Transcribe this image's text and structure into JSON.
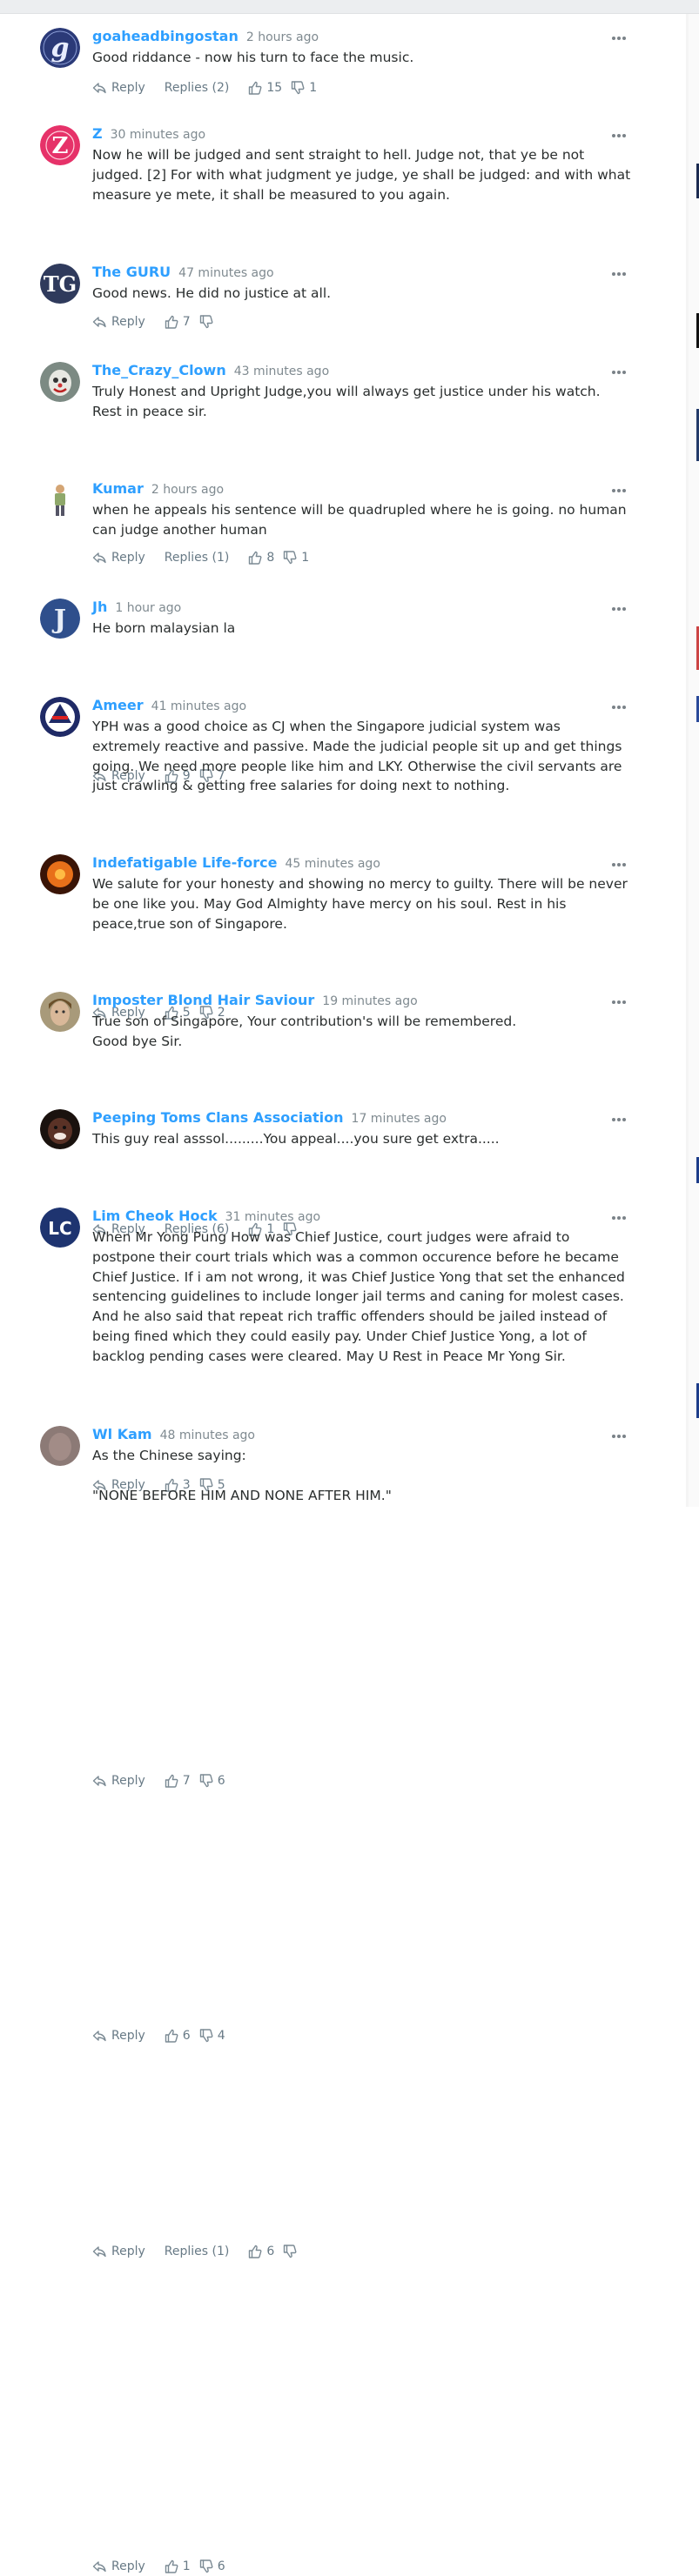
{
  "labels": {
    "reply": "Reply"
  },
  "comments": [
    {
      "author": "goaheadbingostan",
      "time": "2 hours ago",
      "text": "Good riddance - now his turn to face the music.",
      "replies": "Replies (2)",
      "upvotes": "15",
      "downvotes": "1",
      "avatar": "avatar-script-g",
      "avatar_color": "#2b3a78"
    },
    {
      "author": "Z",
      "time": "30 minutes ago",
      "text": "Now he will be judged and sent straight to hell. Judge not, that ye be not judged. [2] For with what judgment ye judge, ye shall be judged: and with what measure ye mete, it shall be measured to you again.",
      "replies": "",
      "upvotes": "7",
      "downvotes": "",
      "avatar": "avatar-letter-z",
      "avatar_color": "#e63269"
    },
    {
      "author": "The GURU",
      "time": "47 minutes ago",
      "text": "Good news. He did no justice at all.",
      "replies": "Replies (1)",
      "upvotes": "8",
      "downvotes": "1",
      "avatar": "avatar-tg",
      "avatar_color": "#2f3a5c"
    },
    {
      "author": "The_Crazy_Clown",
      "time": "43 minutes ago",
      "text": "Truly Honest and Upright Judge,you will always get justice under his watch.\nRest in peace sir.",
      "replies": "",
      "upvotes": "9",
      "downvotes": "7",
      "avatar": "avatar-clown",
      "avatar_color": "#7c8a83"
    },
    {
      "author": "Kumar",
      "time": "2 hours ago",
      "text": "when he appeals his sentence will be quadrupled where he is going. no human can judge another human",
      "replies": "",
      "upvotes": "5",
      "downvotes": "2",
      "avatar": "avatar-figure",
      "avatar_color": "#8fa86b"
    },
    {
      "author": "Jh",
      "time": "1 hour ago",
      "text": "He born malaysian la",
      "replies": "Replies (6)",
      "upvotes": "1",
      "downvotes": "",
      "avatar": "avatar-letter-j",
      "avatar_color": "#2f4f8c"
    },
    {
      "author": "Ameer",
      "time": "41 minutes ago",
      "text": "YPH was a good choice as CJ when the Singapore judicial system was extremely reactive and passive. Made the judicial people sit up and get things going. We need more people like him and LKY. Otherwise the civil servants are just crawling & getting free salaries for doing next to nothing.",
      "replies": "",
      "upvotes": "3",
      "downvotes": "5",
      "avatar": "avatar-letter-a",
      "avatar_color": "#1f2a66"
    },
    {
      "author": "Indefatigable Life-force",
      "time": "45 minutes ago",
      "text": "We salute for your honesty and showing no mercy to guilty. There will be never be one like you. May God Almighty have mercy on his soul. Rest in his peace,true son of Singapore.",
      "replies": "",
      "upvotes": "7",
      "downvotes": "6",
      "avatar": "avatar-orange-ball",
      "avatar_color": "#e8701a"
    },
    {
      "author": "Imposter Blond Hair Saviour",
      "time": "19 minutes ago",
      "text": "True son of Singapore, Your contribution's will be remembered.\nGood bye Sir.",
      "replies": "",
      "upvotes": "6",
      "downvotes": "4",
      "avatar": "avatar-face-blond",
      "avatar_color": "#a89a7a"
    },
    {
      "author": "Peeping Toms Clans Association",
      "time": "17 minutes ago",
      "text": "This guy real asssol.........You appeal....you sure get extra.....",
      "replies": "Replies (1)",
      "upvotes": "6",
      "downvotes": "",
      "avatar": "avatar-face-dark",
      "avatar_color": "#5a3226"
    },
    {
      "author": "Lim Cheok Hock",
      "time": "31 minutes ago",
      "text": "When Mr Yong Pung How was Chief Justice, court judges were afraid to postpone their court trials which was a common occurence before he became Chief Justice. If i am not wrong, it was Chief Justice Yong that set the enhanced sentencing guidelines to include longer jail terms and caning for molest cases. And he also said that repeat rich traffic offenders should be jailed instead of being fined which they could easily pay. Under Chief Justice Yong, a lot of backlog pending cases were cleared. May U Rest in Peace Mr Yong Sir.",
      "replies": "",
      "upvotes": "1",
      "downvotes": "6",
      "avatar": "avatar-lc",
      "avatar_color": "#1e3470"
    },
    {
      "author": "Wl Kam",
      "time": "48 minutes ago",
      "text": "As the Chinese saying:\n\n\"NONE BEFORE HIM AND NONE AFTER HIM.\"",
      "replies": "",
      "upvotes": "",
      "downvotes": "",
      "avatar": "avatar-blurred-face",
      "avatar_color": "#8c7a76"
    }
  ]
}
